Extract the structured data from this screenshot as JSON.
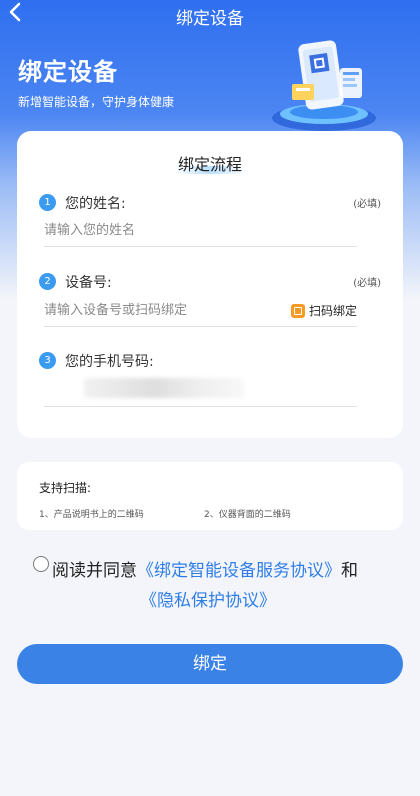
{
  "nav": {
    "title": "绑定设备"
  },
  "hero": {
    "title": "绑定设备",
    "subtitle": "新增智能设备，守护身体健康"
  },
  "card": {
    "title": "绑定流程",
    "steps": [
      {
        "num": "1",
        "label": "您的姓名:",
        "required": "(必填)",
        "placeholder": "请输入您的姓名"
      },
      {
        "num": "2",
        "label": "设备号:",
        "required": "(必填)",
        "placeholder": "请输入设备号或扫码绑定",
        "action": "扫码绑定"
      },
      {
        "num": "3",
        "label": "您的手机号码:"
      }
    ]
  },
  "support": {
    "title": "支持扫描:",
    "items": [
      "1、产品说明书上的二维码",
      "2、仪器背面的二维码"
    ]
  },
  "agreement": {
    "prefix": "阅读并同意",
    "link1": "《绑定智能设备服务协议》",
    "middle": "和",
    "link2": "《隐私保护协议》"
  },
  "button": {
    "label": "绑定"
  },
  "colors": {
    "primary": "#3a82e6",
    "step_badge": "#3a9bf0",
    "link": "#2f7ee8",
    "scan_icon": "#f59b23"
  }
}
